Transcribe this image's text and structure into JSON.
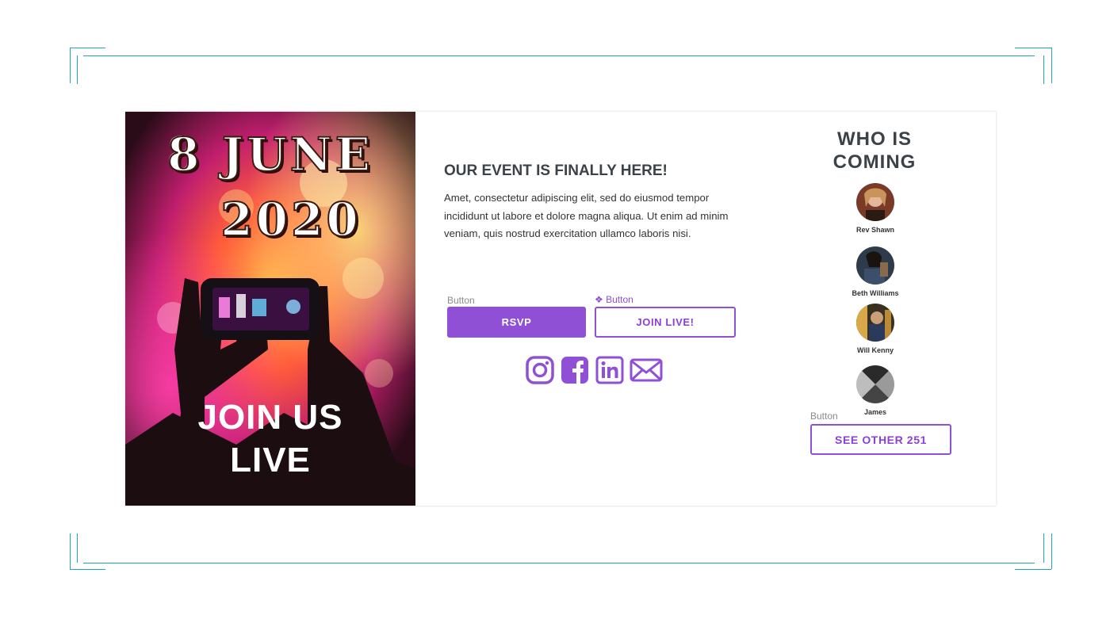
{
  "poster": {
    "date_line1": "8 JUNE",
    "date_line2": "2020",
    "join_line1": "JOIN US",
    "join_line2": "LIVE"
  },
  "event": {
    "headline": "OUR EVENT IS FINALLY HERE!",
    "description": "Amet, consectetur adipiscing elit, sed do eiusmod tempor incididunt ut labore et dolore magna aliqua. Ut enim ad minim veniam, quis nostrud exercitation ullamco laboris nisi.",
    "rsvp_component_label": "Button",
    "rsvp_label": "RSVP",
    "join_component_label": "❖ Button",
    "join_label": "JOIN LIVE!"
  },
  "socials": [
    "instagram-icon",
    "facebook-icon",
    "linkedin-icon",
    "mail-icon"
  ],
  "attendees": {
    "title_line1": "WHO IS",
    "title_line2": "COMING",
    "list": [
      {
        "name": "Rev Shawn"
      },
      {
        "name": "Beth Williams"
      },
      {
        "name": "Will Kenny"
      },
      {
        "name": "James"
      }
    ],
    "see_more_component_label": "Button",
    "see_more_label": "SEE OTHER 251"
  },
  "colors": {
    "accent": "#9050d6",
    "frame": "#1fa6b3",
    "heading": "#3b4248"
  }
}
